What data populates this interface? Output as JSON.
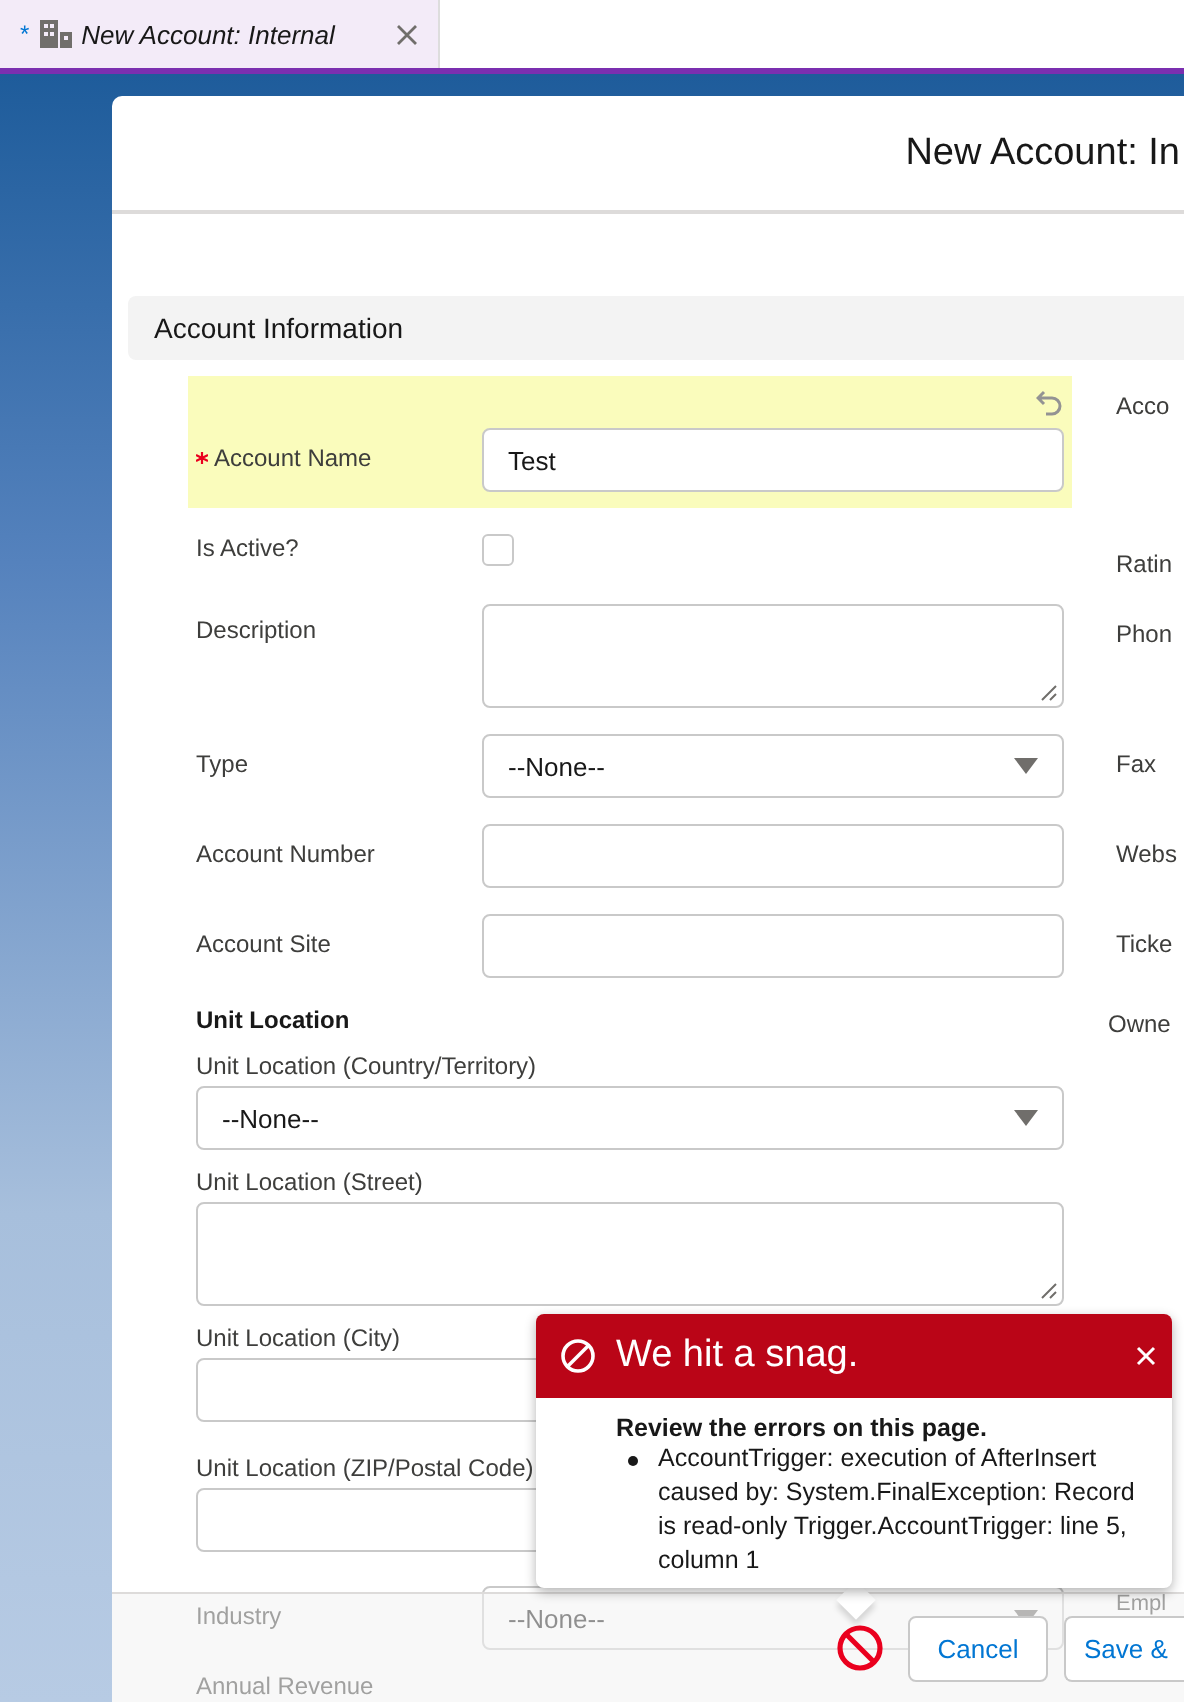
{
  "tab": {
    "marker": "*",
    "title": "New Account: Internal",
    "selected": true
  },
  "modal": {
    "title": "New Account: In"
  },
  "section": {
    "title": "Account Information"
  },
  "fields": [
    {
      "kind": "text",
      "label": "Account Name",
      "required": true,
      "highlighted": true,
      "value": "Test",
      "right_label": "Acco"
    },
    {
      "kind": "checkbox",
      "label": "Is Active?",
      "required": false,
      "highlighted": false,
      "checked": false,
      "right_label": "Ratin"
    },
    {
      "kind": "textarea",
      "label": "Description",
      "required": false,
      "highlighted": false,
      "right_label": "Phon"
    },
    {
      "kind": "select",
      "label": "Type",
      "required": false,
      "highlighted": false,
      "value": "--None--",
      "right_label": "Fax"
    },
    {
      "kind": "text",
      "label": "Account Number",
      "required": false,
      "highlighted": false,
      "right_label": "Webs"
    },
    {
      "kind": "text",
      "label": "Account Site",
      "required": false,
      "highlighted": false,
      "right_label": "Ticke"
    }
  ],
  "address": {
    "title": "Unit Location",
    "right_label": "Owne",
    "fields": [
      {
        "kind": "select",
        "label": "Unit Location (Country/Territory)",
        "value": "--None--"
      },
      {
        "kind": "textarea",
        "label": "Unit Location (Street)"
      },
      {
        "kind": "text",
        "label": "Unit Location (City)"
      },
      {
        "kind": "text",
        "label": "Unit Location (ZIP/Postal Code)"
      }
    ]
  },
  "faded_fields": [
    {
      "kind": "select",
      "label": "Industry",
      "value": "--None--",
      "right_label": "Empl"
    },
    {
      "kind": "label",
      "label": "Annual Revenue"
    }
  ],
  "error_toast": {
    "title": "We hit a snag.",
    "heading": "Review the errors on this page.",
    "errors": [
      "AccountTrigger: execution of AfterInsert caused by: System.FinalException: Record is read-only Trigger.AccountTrigger: line 5, column 1"
    ]
  },
  "footer": {
    "buttons": [
      "Cancel",
      "Save &"
    ]
  }
}
